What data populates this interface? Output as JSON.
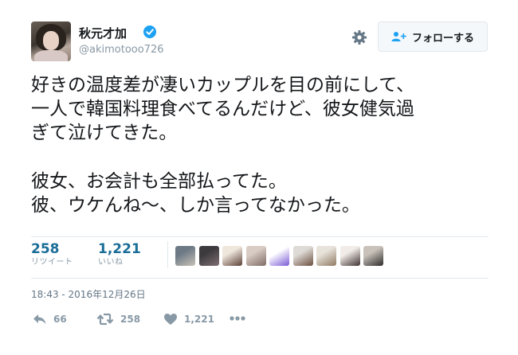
{
  "user": {
    "display_name": "秋元才加",
    "handle": "@akimotooo726",
    "verified": true
  },
  "header": {
    "follow_label": "フォローする",
    "settings_icon": "gear-icon",
    "follow_icon": "follow-user-icon"
  },
  "tweet": {
    "lines": [
      "好きの温度差が凄いカップルを目の前にして、",
      "一人で韓国料理食べてるんだけど、彼女健気過",
      "ぎて泣けてきた。",
      "",
      "彼女、お会計も全部払ってた。",
      "彼、ウケんね〜、しか言ってなかった。"
    ]
  },
  "stats": {
    "retweets": {
      "value": "258",
      "label": "リツイート"
    },
    "likes": {
      "value": "1,221",
      "label": "いいね"
    }
  },
  "likers": [
    {
      "name": "liker-avatar-1",
      "colors": [
        "#6d7a86",
        "#c9c2b8"
      ]
    },
    {
      "name": "liker-avatar-2",
      "colors": [
        "#3c3a3d",
        "#7f6f74"
      ]
    },
    {
      "name": "liker-avatar-3",
      "colors": [
        "#efe6dc",
        "#5a3f34"
      ]
    },
    {
      "name": "liker-avatar-4",
      "colors": [
        "#d8ccc4",
        "#7e6a64"
      ]
    },
    {
      "name": "liker-avatar-5",
      "colors": [
        "#ffffff",
        "#7b5ad6"
      ]
    },
    {
      "name": "liker-avatar-6",
      "colors": [
        "#dedbd6",
        "#6b4e3d"
      ]
    },
    {
      "name": "liker-avatar-7",
      "colors": [
        "#e7e2da",
        "#8f7a63"
      ]
    },
    {
      "name": "liker-avatar-8",
      "colors": [
        "#f1ece8",
        "#3d3030"
      ]
    },
    {
      "name": "liker-avatar-9",
      "colors": [
        "#c9c2bb",
        "#2c2a29"
      ]
    }
  ],
  "timestamp": "18:43 - 2016年12月26日",
  "actions": {
    "reply_count": "66",
    "retweet_count": "258",
    "like_count": "1,221",
    "reply_icon": "reply-icon",
    "retweet_icon": "retweet-icon",
    "like_icon": "heart-icon",
    "more_icon": "more-icon"
  },
  "colors": {
    "link_blue": "#1b6e98",
    "verified_blue": "#1da1f2",
    "muted_gray": "#8899a6"
  }
}
